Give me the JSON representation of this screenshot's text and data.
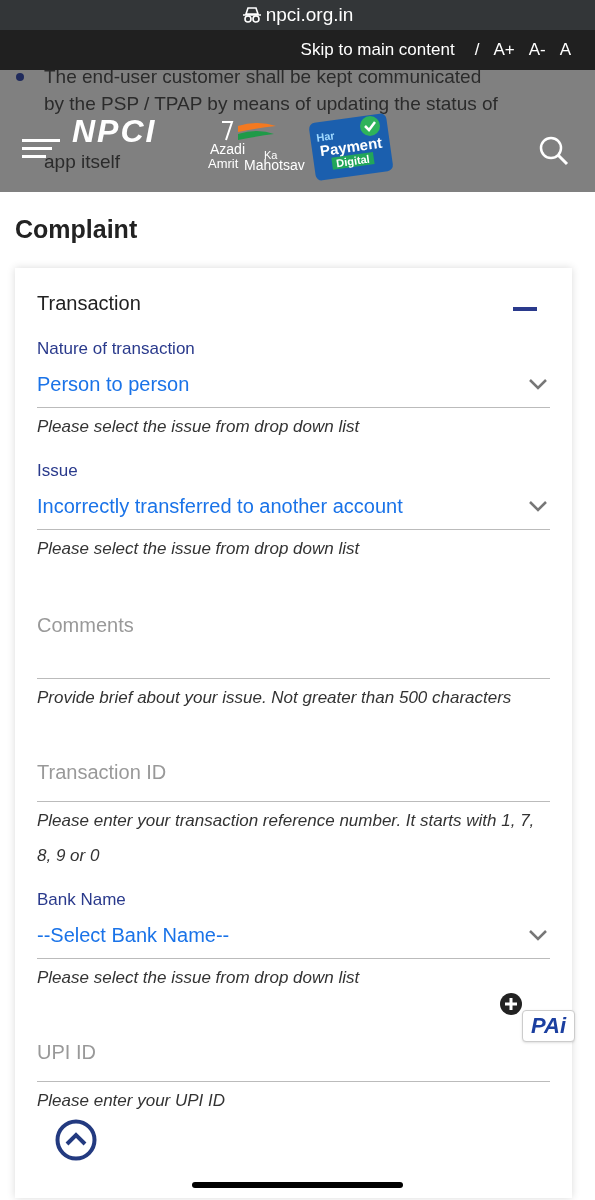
{
  "browser": {
    "url": "npci.org.in"
  },
  "top_links": [
    "Skip to main content",
    "/",
    "A+",
    "A-",
    "A"
  ],
  "bullet_lines": [
    "The end-user customer shall be kept communicated",
    "by the PSP / TPAP by means of updating the status of",
    "app itself"
  ],
  "logos": {
    "npci": "NPCI",
    "azadi": [
      "Azadi",
      "Ka",
      "Amrit",
      "Mahotsav"
    ],
    "har_payment": [
      "Har",
      "Payment",
      "Digital"
    ]
  },
  "page_title": "Complaint",
  "section": {
    "title": "Transaction",
    "expanded": true
  },
  "fields": [
    {
      "kind": "select",
      "label": "Nature of transaction",
      "value": "Person to person",
      "hint": "Please select the issue from drop down list"
    },
    {
      "kind": "select",
      "label": "Issue",
      "value": "Incorrectly transferred to another account",
      "hint": "Please select the issue from drop down list"
    },
    {
      "kind": "textarea",
      "placeholder": "Comments",
      "hint": "Provide brief about your issue. Not greater than 500 characters"
    },
    {
      "kind": "input",
      "placeholder": "Transaction ID",
      "hint": "Please enter your transaction reference number. It starts with 1, 7, 8, 9 or 0"
    },
    {
      "kind": "select",
      "label": "Bank Name",
      "value": "--Select Bank Name--",
      "hint": "Please select the issue from drop down list"
    },
    {
      "kind": "input",
      "placeholder": "UPI ID",
      "hint": "Please enter your UPI ID"
    }
  ],
  "chat_badge": "PAi"
}
